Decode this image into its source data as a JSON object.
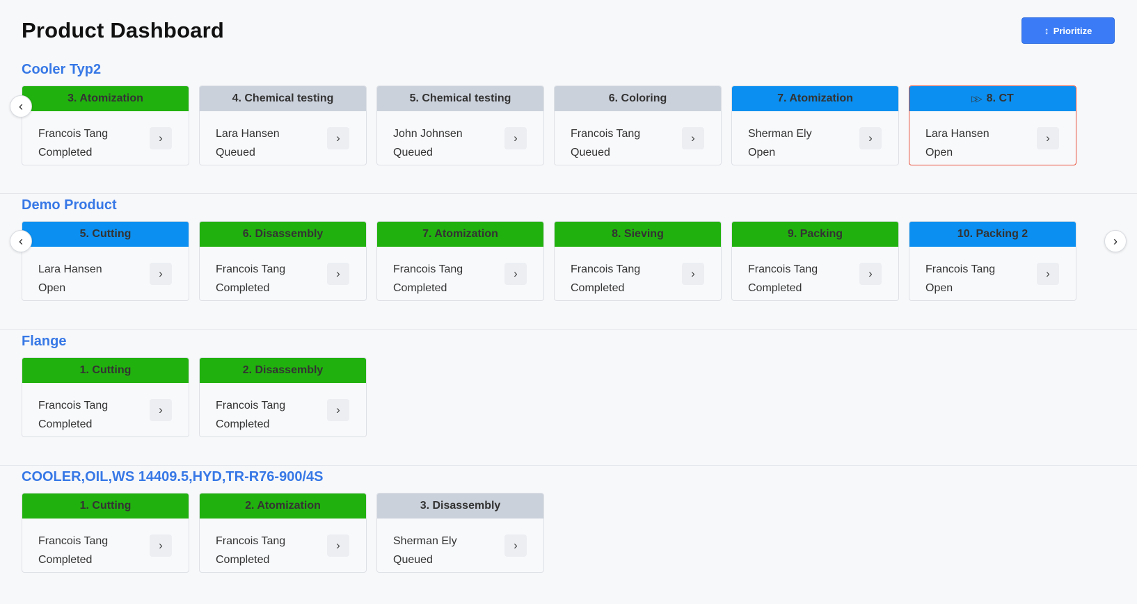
{
  "header": {
    "title": "Product Dashboard",
    "prioritize_label": "Prioritize"
  },
  "icons": {
    "sort": "up-down-arrow-icon",
    "chevron_right": "chevron-right-icon",
    "chevron_left": "chevron-left-icon",
    "fast_forward": "fast-forward-icon"
  },
  "colors": {
    "completed": "#21b10e",
    "open": "#0b8ff0",
    "queued": "#cbd1db",
    "accent": "#3b7cf6",
    "current_border": "#e8503a"
  },
  "products": [
    {
      "name": "Cooler Typ2",
      "steps": [
        {
          "label": "3. Atomization",
          "assignee": "Francois Tang",
          "status": "Completed"
        },
        {
          "label": "4. Chemical testing",
          "assignee": "Lara Hansen",
          "status": "Queued"
        },
        {
          "label": "5. Chemical testing",
          "assignee": "John Johnsen",
          "status": "Queued"
        },
        {
          "label": "6. Coloring",
          "assignee": "Francois Tang",
          "status": "Queued"
        },
        {
          "label": "7. Atomization",
          "assignee": "Sherman Ely",
          "status": "Open"
        },
        {
          "label": "8. CT",
          "assignee": "Lara Hansen",
          "status": "Open"
        }
      ]
    },
    {
      "name": "Demo Product",
      "steps": [
        {
          "label": "5. Cutting",
          "assignee": "Lara Hansen",
          "status": "Open"
        },
        {
          "label": "6. Disassembly",
          "assignee": "Francois Tang",
          "status": "Completed"
        },
        {
          "label": "7. Atomization",
          "assignee": "Francois Tang",
          "status": "Completed"
        },
        {
          "label": "8. Sieving",
          "assignee": "Francois Tang",
          "status": "Completed"
        },
        {
          "label": "9. Packing",
          "assignee": "Francois Tang",
          "status": "Completed"
        },
        {
          "label": "10. Packing 2",
          "assignee": "Francois Tang",
          "status": "Open"
        }
      ]
    },
    {
      "name": "Flange",
      "steps": [
        {
          "label": "1. Cutting",
          "assignee": "Francois Tang",
          "status": "Completed"
        },
        {
          "label": "2. Disassembly",
          "assignee": "Francois Tang",
          "status": "Completed"
        }
      ]
    },
    {
      "name": "COOLER,OIL,WS 14409.5,HYD,TR-R76-900/4S",
      "steps": [
        {
          "label": "1. Cutting",
          "assignee": "Francois Tang",
          "status": "Completed"
        },
        {
          "label": "2. Atomization",
          "assignee": "Francois Tang",
          "status": "Completed"
        },
        {
          "label": "3. Disassembly",
          "assignee": "Sherman Ely",
          "status": "Queued"
        }
      ]
    }
  ]
}
